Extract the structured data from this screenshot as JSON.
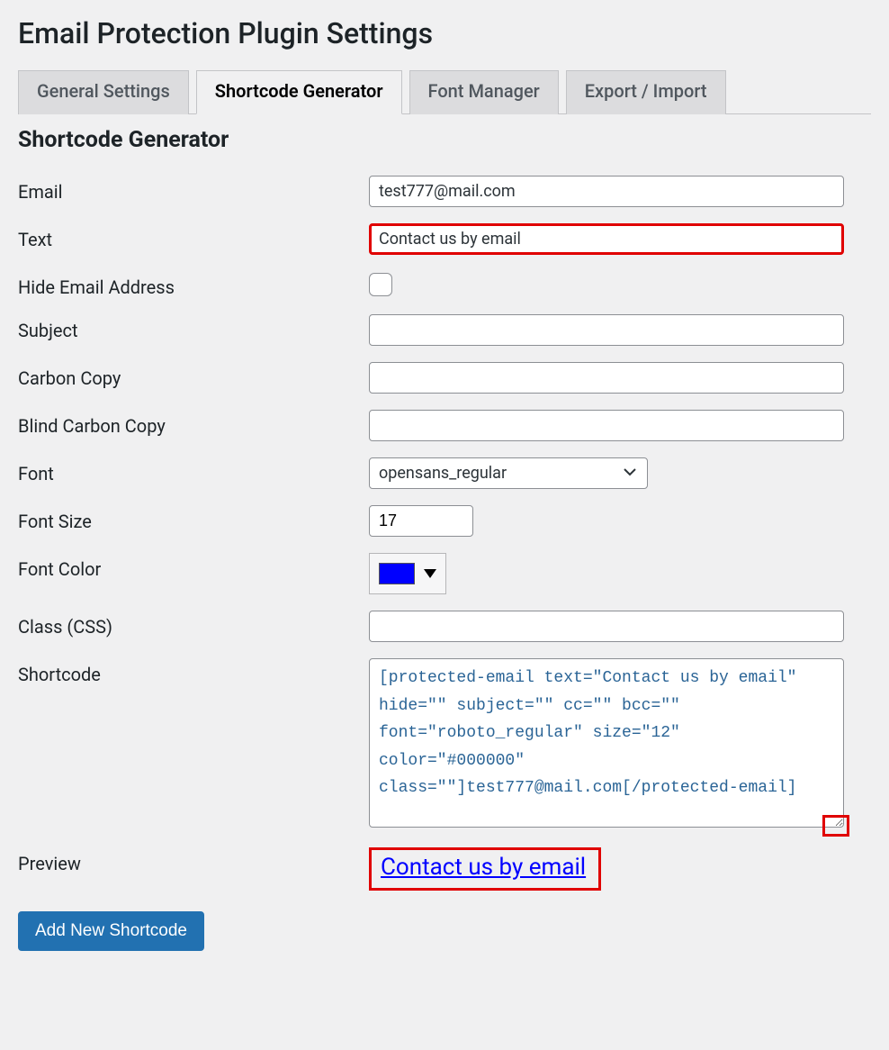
{
  "page_title": "Email Protection Plugin Settings",
  "tabs": {
    "general": "General Settings",
    "shortcode": "Shortcode Generator",
    "font_manager": "Font Manager",
    "export_import": "Export / Import"
  },
  "active_tab": "shortcode",
  "section_title": "Shortcode Generator",
  "labels": {
    "email": "Email",
    "text": "Text",
    "hide_email": "Hide Email Address",
    "subject": "Subject",
    "cc": "Carbon Copy",
    "bcc": "Blind Carbon Copy",
    "font": "Font",
    "font_size": "Font Size",
    "font_color": "Font Color",
    "class_css": "Class (CSS)",
    "shortcode": "Shortcode",
    "preview": "Preview"
  },
  "values": {
    "email": "test777@mail.com",
    "text": "Contact us by email",
    "hide_email_checked": false,
    "subject": "",
    "cc": "",
    "bcc": "",
    "font": "opensans_regular",
    "font_size": "17",
    "font_color": "#0000ff",
    "class_css": "",
    "shortcode_output": "[protected-email text=\"Contact us by email\" hide=\"\" subject=\"\" cc=\"\" bcc=\"\" font=\"roboto_regular\" size=\"12\" color=\"#000000\" class=\"\"]test777@mail.com[/protected-email]",
    "preview_text": "Contact us by email"
  },
  "button": {
    "add_new": "Add New Shortcode"
  }
}
